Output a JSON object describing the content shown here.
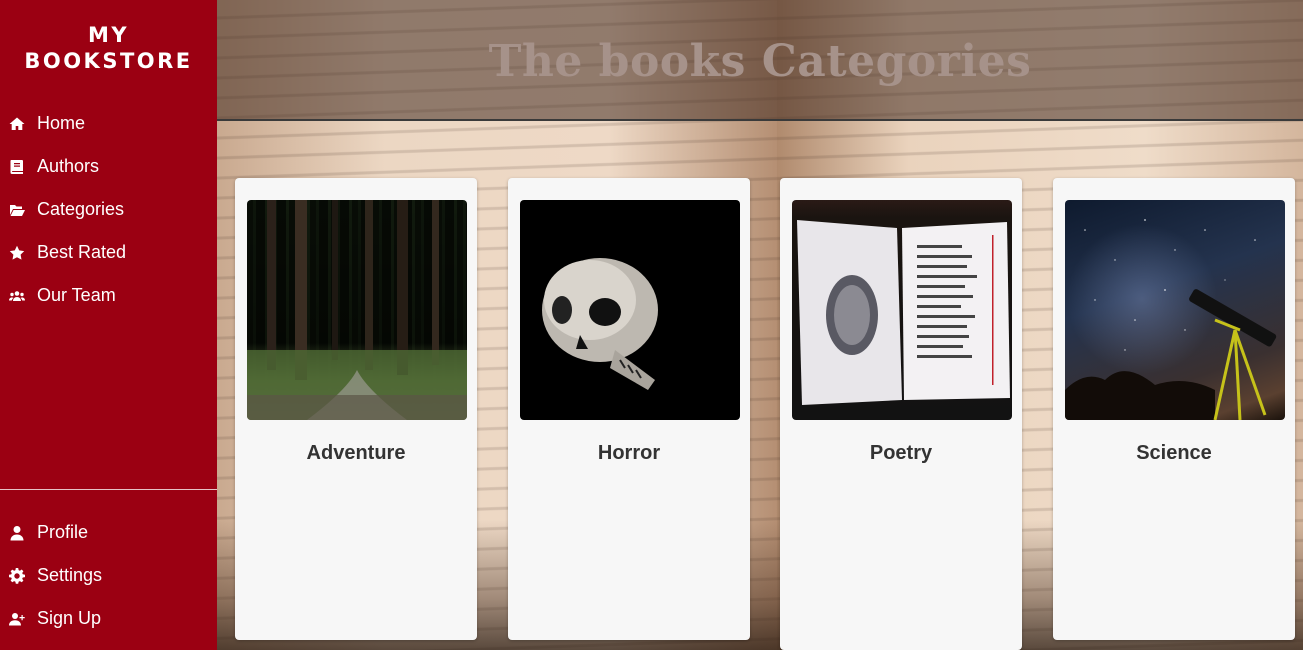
{
  "brand": {
    "line1": "MY",
    "line2": "BOOKSTORE"
  },
  "page": {
    "title": "The books Categories"
  },
  "nav": {
    "main": [
      {
        "label": "Home",
        "icon": "home-icon"
      },
      {
        "label": "Authors",
        "icon": "book-icon"
      },
      {
        "label": "Categories",
        "icon": "folder-open-icon"
      },
      {
        "label": "Best Rated",
        "icon": "star-icon"
      },
      {
        "label": "Our Team",
        "icon": "users-icon"
      }
    ],
    "account": [
      {
        "label": "Profile",
        "icon": "user-icon"
      },
      {
        "label": "Settings",
        "icon": "gear-icon"
      },
      {
        "label": "Sign Up",
        "icon": "user-plus-icon"
      }
    ]
  },
  "categories": [
    {
      "label": "Adventure",
      "image": "forest"
    },
    {
      "label": "Horror",
      "image": "skull"
    },
    {
      "label": "Poetry",
      "image": "open-book-fingerprint"
    },
    {
      "label": "Science",
      "image": "telescope-night-sky"
    }
  ],
  "colors": {
    "sidebar": "#9b0012",
    "title": "#a6928a",
    "card": "#f7f7f7"
  }
}
